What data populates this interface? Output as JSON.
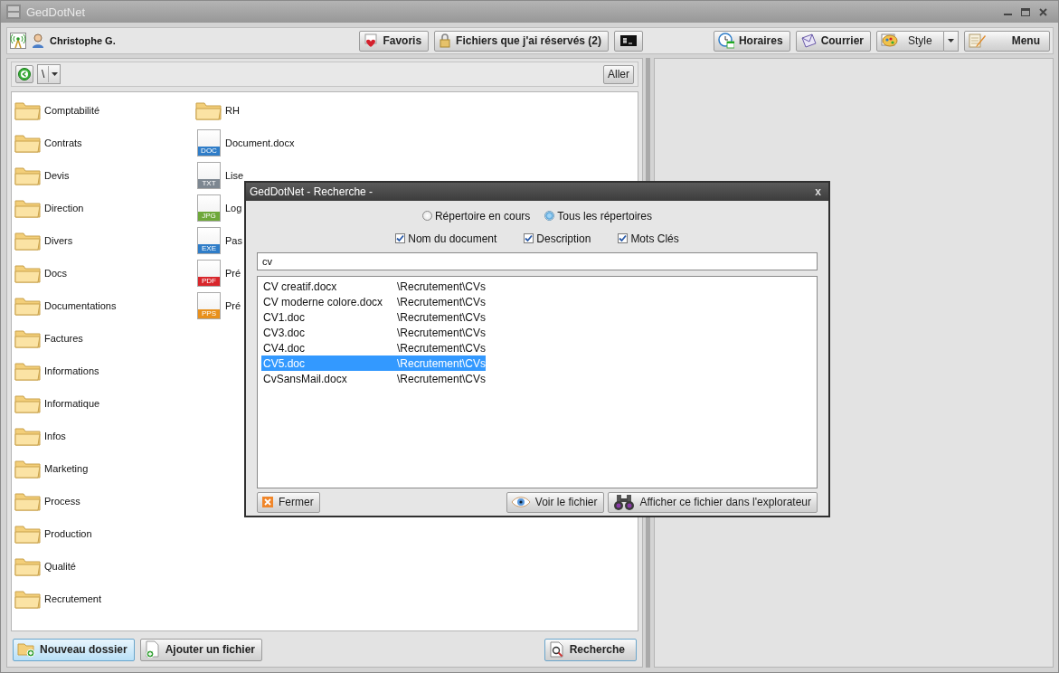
{
  "window": {
    "title": "GedDotNet"
  },
  "toolbar": {
    "user": "Christophe G.",
    "left_buttons": [
      {
        "label": "Favoris"
      },
      {
        "label": "Fichiers que j'ai réservés (2)"
      }
    ],
    "right_buttons": [
      {
        "label": "Horaires"
      },
      {
        "label": "Courrier"
      },
      {
        "label": "Style",
        "kind": "split"
      },
      {
        "label": "Menu"
      }
    ]
  },
  "nav": {
    "path": "\\",
    "go_button": "Aller"
  },
  "files": {
    "column_1": [
      {
        "name": "Comptabilité",
        "kind": "folder"
      },
      {
        "name": "Contrats",
        "kind": "folder"
      },
      {
        "name": "Devis",
        "kind": "folder"
      },
      {
        "name": "Direction",
        "kind": "folder"
      },
      {
        "name": "Divers",
        "kind": "folder"
      },
      {
        "name": "Docs",
        "kind": "folder"
      },
      {
        "name": "Documentations",
        "kind": "folder"
      },
      {
        "name": "Factures",
        "kind": "folder"
      },
      {
        "name": "Informations",
        "kind": "folder"
      },
      {
        "name": "Informatique",
        "kind": "folder"
      },
      {
        "name": "Infos",
        "kind": "folder"
      },
      {
        "name": "Marketing",
        "kind": "folder"
      },
      {
        "name": "Process",
        "kind": "folder"
      },
      {
        "name": "Production",
        "kind": "folder"
      },
      {
        "name": "Qualité",
        "kind": "folder"
      },
      {
        "name": "Recrutement",
        "kind": "folder"
      }
    ],
    "column_2": [
      {
        "name": "RH",
        "kind": "folder"
      },
      {
        "name": "Document.docx",
        "kind": "file",
        "badge": "DOC",
        "color": "#2f7dc8"
      },
      {
        "name": "Lise",
        "kind": "file",
        "badge": "TXT",
        "color": "#7d8791"
      },
      {
        "name": "Log",
        "kind": "file",
        "badge": "JPG",
        "color": "#6ea83a"
      },
      {
        "name": "Pas",
        "kind": "file",
        "badge": "EXE",
        "color": "#2f7dc8"
      },
      {
        "name": "Pré",
        "kind": "file",
        "badge": "PDF",
        "color": "#d8262b"
      },
      {
        "name": "Pré",
        "kind": "file",
        "badge": "PPS",
        "color": "#e8901c"
      }
    ]
  },
  "bottom_buttons": [
    {
      "label": "Nouveau dossier",
      "focused": true
    },
    {
      "label": "Ajouter un fichier",
      "focused": false
    }
  ],
  "search_button": {
    "label": "Recherche"
  },
  "dialog": {
    "title": "GedDotNet - Recherche -",
    "close": "x",
    "scopes": [
      {
        "label": "Répertoire en cours",
        "selected": false
      },
      {
        "label": "Tous les répertoires",
        "selected": true
      }
    ],
    "fields": [
      {
        "label": "Nom du document",
        "checked": true
      },
      {
        "label": "Description",
        "checked": true
      },
      {
        "label": "Mots Clés",
        "checked": true
      }
    ],
    "query": "cv",
    "results": [
      {
        "name": "CV creatif.docx",
        "path": "\\Recrutement\\CVs",
        "selected": false
      },
      {
        "name": "CV moderne colore.docx",
        "path": "\\Recrutement\\CVs",
        "selected": false
      },
      {
        "name": "CV1.doc",
        "path": "\\Recrutement\\CVs",
        "selected": false
      },
      {
        "name": "CV3.doc",
        "path": "\\Recrutement\\CVs",
        "selected": false
      },
      {
        "name": "CV4.doc",
        "path": "\\Recrutement\\CVs",
        "selected": false
      },
      {
        "name": "CV5.doc",
        "path": "\\Recrutement\\CVs",
        "selected": true
      },
      {
        "name": "CvSansMail.docx",
        "path": "\\Recrutement\\CVs",
        "selected": false
      }
    ],
    "close_button": "Fermer",
    "view_button": "Voir le fichier",
    "explorer_button": "Afficher ce fichier dans l'explorateur"
  }
}
